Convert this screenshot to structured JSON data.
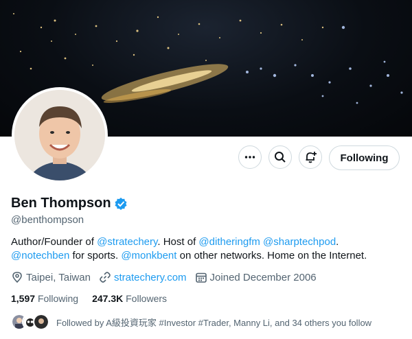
{
  "banner": {
    "alt": "Night-time satellite view of city lights"
  },
  "profile": {
    "name": "Ben Thompson",
    "verified": true,
    "handle": "@benthompson",
    "bio": {
      "t1": "Author/Founder of ",
      "m1": "@stratechery",
      "t2": ". Host of ",
      "m2": "@ditheringfm",
      "t3": " ",
      "m3": "@sharptechpod",
      "t4": ".",
      "m4": "@notechben",
      "t5": " for sports. ",
      "m5": "@monkbent",
      "t6": " on other networks. Home on the Internet."
    },
    "location": "Taipei, Taiwan",
    "website": "stratechery.com",
    "joined": "Joined December 2006",
    "following_count": "1,597",
    "following_label": "Following",
    "followers_count": "247.3K",
    "followers_label": "Followers",
    "followed_by": "Followed by A級投資玩家 #Investor #Trader, Manny Li, and 34 others you follow"
  },
  "actions": {
    "more_icon": "more-horizontal-icon",
    "search_icon": "search-icon",
    "notify_icon": "bell-plus-icon",
    "follow_label": "Following"
  },
  "colors": {
    "link": "#1d9bf0",
    "muted": "#536471",
    "verified": "#1d9bf0"
  }
}
